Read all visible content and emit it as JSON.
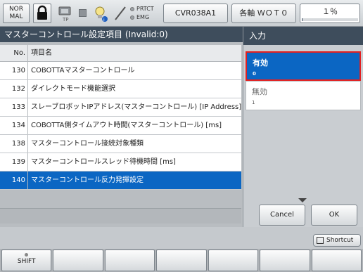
{
  "topbar": {
    "mode_line1": "NOR",
    "mode_line2": "MAL",
    "tp_label": "TP",
    "indicators": [
      "PRTCT",
      "EMG"
    ],
    "program": "CVR038A1",
    "axis": "各軸 ＷＯＴ０",
    "speed": "１％",
    "speed_fraction": 0.01
  },
  "left": {
    "title": "マスターコントロール設定項目 (Invalid:0)",
    "header_no": "No.",
    "header_name": "項目名",
    "rows": [
      {
        "no": "130",
        "name": "COBOTTAマスターコントロール"
      },
      {
        "no": "132",
        "name": "ダイレクトモード機能選択"
      },
      {
        "no": "133",
        "name": "スレーブロボットIPアドレス(マスターコントロール) [IP Address]"
      },
      {
        "no": "134",
        "name": "COBOTTA側タイムアウト時間(マスターコントロール) [ms]"
      },
      {
        "no": "138",
        "name": "マスターコントロール接続対象種類"
      },
      {
        "no": "139",
        "name": "マスターコントロールスレッド待機時間 [ms]"
      },
      {
        "no": "140",
        "name": "マスターコントロール反力発揮設定"
      }
    ],
    "selected_row": 6
  },
  "right": {
    "title": "入力",
    "options": [
      {
        "label": "有効",
        "value": "0"
      },
      {
        "label": "無効",
        "value": "1"
      }
    ],
    "selected_option": 0,
    "cancel": "Cancel",
    "ok": "OK"
  },
  "bottom": {
    "shortcut": "Shortcut",
    "shift": "SHIFT"
  },
  "colors": {
    "selection": "#0b66c3",
    "highlight_border": "#e32020",
    "title_bar": "#3e4d5c"
  }
}
